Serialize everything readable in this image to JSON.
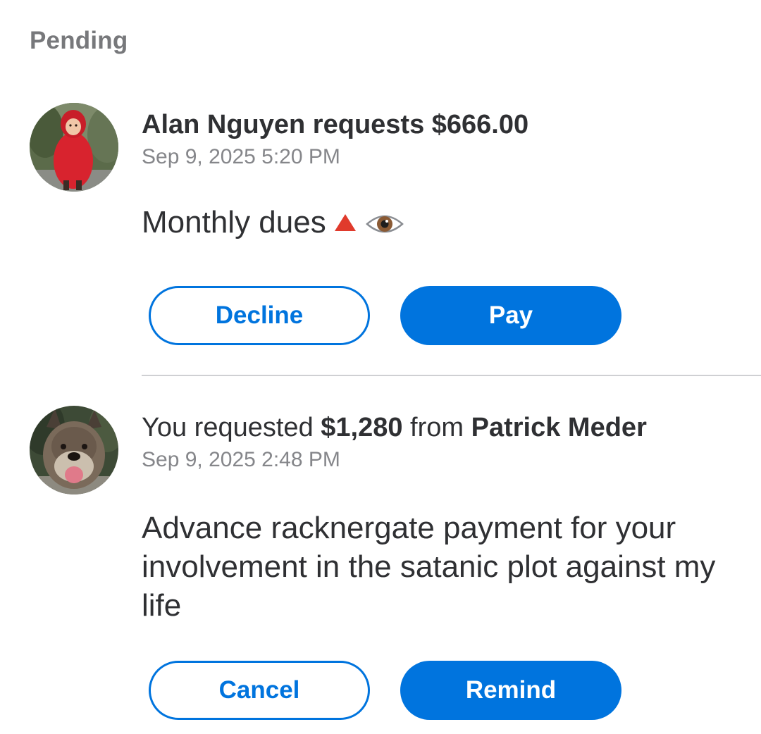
{
  "section": {
    "title": "Pending"
  },
  "requests": [
    {
      "headline": "Alan Nguyen requests $666.00",
      "timestamp": "Sep 9, 2025 5:20 PM",
      "note": "Monthly dues",
      "note_emojis": [
        "red-triangle-icon",
        "eye-icon"
      ],
      "avatar": "child-in-red-jacket-photo",
      "secondary_button": "Decline",
      "primary_button": "Pay"
    },
    {
      "headline_parts": {
        "prefix": "You requested ",
        "amount": "$1,280",
        "middle": " from ",
        "name": "Patrick Meder"
      },
      "timestamp": "Sep 9, 2025 2:48 PM",
      "note": "Advance racknergate payment for your involvement in the satanic plot against my life",
      "avatar": "dog-photo",
      "secondary_button": "Cancel",
      "primary_button": "Remind"
    }
  ],
  "colors": {
    "accent": "#0074de",
    "text": "#2f3033",
    "muted": "#85868a",
    "section_title": "#77787b",
    "divider": "#cfd0d3"
  }
}
